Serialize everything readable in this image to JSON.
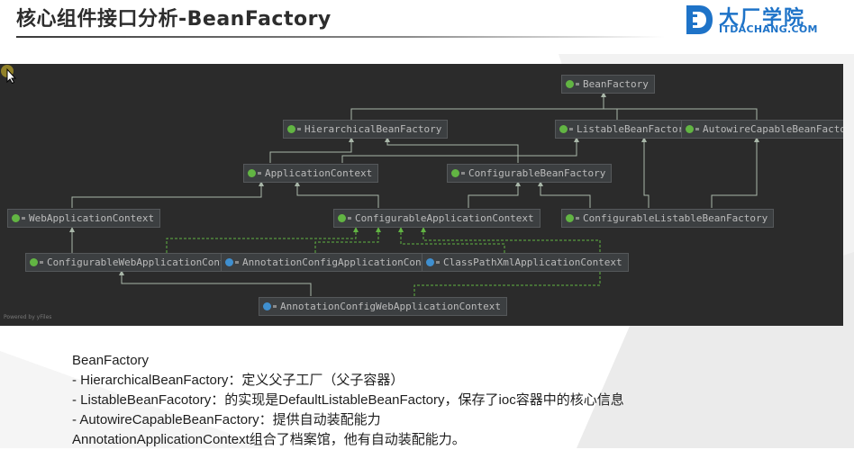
{
  "header": {
    "title": "核心组件接口分析-BeanFactory",
    "logo_cn": "大厂学院",
    "logo_en": "ITDACHANG.COM"
  },
  "diagram": {
    "nodes": {
      "bean_factory": "BeanFactory",
      "hierarchical_bean_factory": "HierarchicalBeanFactory",
      "listable_bean_factory": "ListableBeanFactory",
      "autowire_capable_bean_factory": "AutowireCapableBeanFactory",
      "application_context": "ApplicationContext",
      "configurable_bean_factory": "ConfigurableBeanFactory",
      "web_application_context": "WebApplicationContext",
      "configurable_application_context": "ConfigurableApplicationContext",
      "configurable_listable_bean_factory": "ConfigurableListableBeanFactory",
      "configurable_web_application_context": "ConfigurableWebApplicationContext",
      "annotation_config_application_context": "AnnotationConfigApplicationContext",
      "class_path_xml_application_context": "ClassPathXmlApplicationContext",
      "annotation_config_web_application_context": "AnnotationConfigWebApplicationContext"
    },
    "powered_by": "Powered by yFiles",
    "colors": {
      "background": "#2b2b2b",
      "interface_icon": "#62b543",
      "class_icon": "#3f8fcf",
      "edge_solid": "#a9b7a9",
      "edge_dashed": "#62b543"
    }
  },
  "notes": {
    "line1": "BeanFactory",
    "line2": "- HierarchicalBeanFactory：定义父子工厂（父子容器）",
    "line3": "- ListableBeanFacotory：的实现是DefaultListableBeanFactory，保存了ioc容器中的核心信息",
    "line4": "- AutowireCapableBeanFactory：提供自动装配能力",
    "line5": "AnnotationApplicationContext组合了档案馆，他有自动装配能力。"
  }
}
